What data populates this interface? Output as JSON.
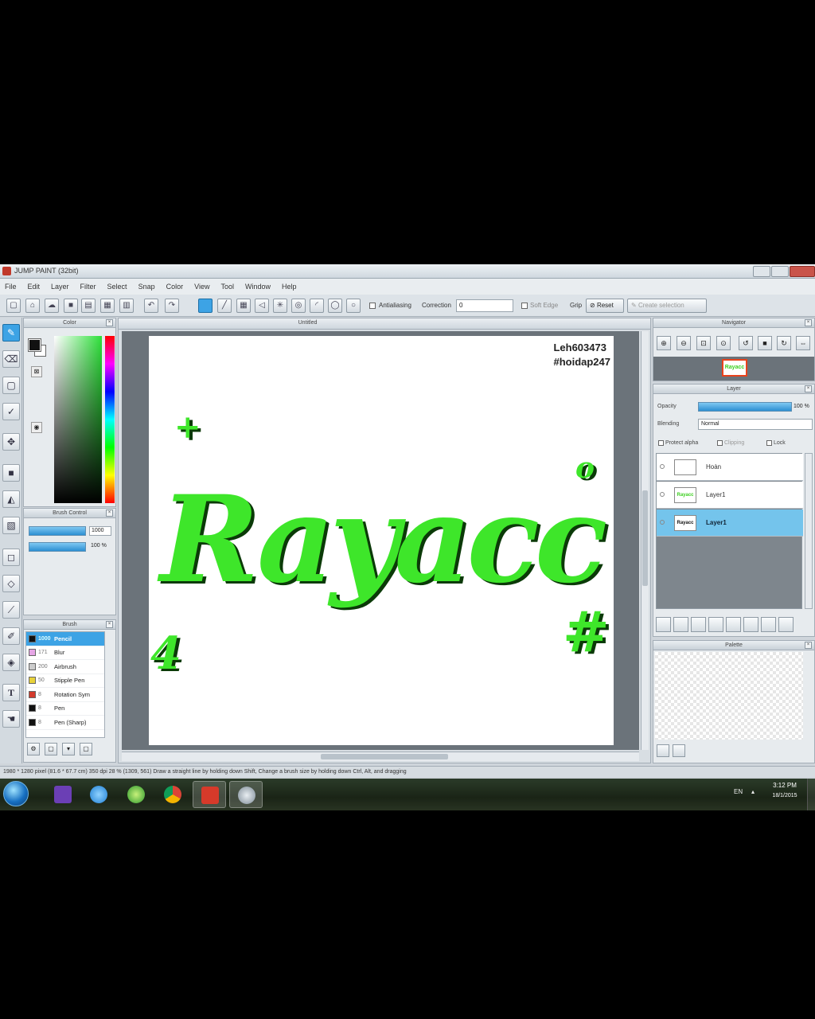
{
  "window": {
    "title": "JUMP PAINT (32bit)"
  },
  "menu": [
    "File",
    "Edit",
    "Layer",
    "Filter",
    "Select",
    "Snap",
    "Color",
    "View",
    "Tool",
    "Window",
    "Help"
  ],
  "toolbar": {
    "antialiasing_label": "Antialiasing",
    "correction_label": "Correction",
    "correction_value": "0",
    "soft_edge_label": "Soft Edge",
    "grip_label": "Grip",
    "reset_label": "Reset",
    "create_selection_label": "Create selection"
  },
  "panels": {
    "color": "Color",
    "brush_control": "Brush Control",
    "brush": "Brush",
    "navigator": "Navigator",
    "layer": "Layer",
    "palette": "Palette"
  },
  "brush_control": {
    "size_value": "1000",
    "density_value": "100 %",
    "size_fraction": 1.0,
    "density_fraction": 1.0
  },
  "brushes": [
    {
      "size": "1000",
      "name": "Pencil",
      "color": "#111111",
      "selected": true
    },
    {
      "size": "171",
      "name": "Blur",
      "color": "#e6a6e6",
      "selected": false
    },
    {
      "size": "200",
      "name": "Airbrush",
      "color": "#cccccc",
      "selected": false
    },
    {
      "size": "50",
      "name": "Stipple Pen",
      "color": "#e8d23a",
      "selected": false
    },
    {
      "size": "8",
      "name": "Rotation Sym",
      "color": "#d33a2c",
      "selected": false
    },
    {
      "size": "8",
      "name": "Pen",
      "color": "#111111",
      "selected": false
    },
    {
      "size": "8",
      "name": "Pen (Sharp)",
      "color": "#111111",
      "selected": false
    }
  ],
  "document": {
    "tab_title": "Untitled"
  },
  "watermark": {
    "line1": "Leh603473",
    "line2": "#hoidap247"
  },
  "artwork": {
    "text": "Rayacc",
    "color": "#3ee62a",
    "shadow": "#0b3a08"
  },
  "layer_panel": {
    "opacity_label": "Opacity",
    "opacity_value": "100 %",
    "blending_label": "Blending",
    "blending_value": "Normal",
    "protect_alpha": "Protect alpha",
    "clipping": "Clipping",
    "lock": "Lock",
    "layers": [
      {
        "name": "Hoàn",
        "selected": false
      },
      {
        "name": "Layer1",
        "selected": false
      },
      {
        "name": "Layer1",
        "selected": true
      }
    ]
  },
  "status": {
    "text": "1980 * 1280 pixel  (81.6 * 67.7 cm)  350 dpi  28 %  (1309, 561)  Draw a straight line by holding down Shift, Change a brush size by holding down Ctrl, Alt, and dragging"
  },
  "taskbar": {
    "language": "EN",
    "time": "3:12 PM",
    "date": "18/1/2015"
  },
  "colors": {
    "accent": "#3da3e5",
    "art_green": "#3ee62a"
  }
}
